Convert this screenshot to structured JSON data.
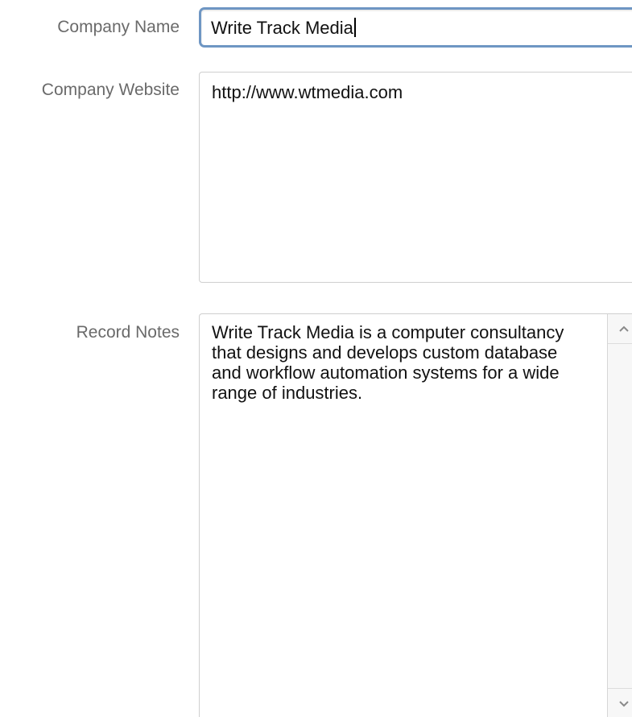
{
  "form": {
    "company_name": {
      "label": "Company Name",
      "value": "Write Track Media"
    },
    "company_website": {
      "label": "Company Website",
      "value": "http://www.wtmedia.com"
    },
    "record_notes": {
      "label": "Record Notes",
      "value": "Write Track Media is a computer consultancy that designs and develops custom database and workflow automation systems for a wide range of industries."
    }
  },
  "icons": {
    "scroll_up": "chevron-up-icon",
    "scroll_down": "chevron-down-icon"
  },
  "colors": {
    "focus_border": "#6e96c3",
    "label_text": "#6a6a6a",
    "field_border": "#cfcfcf"
  }
}
